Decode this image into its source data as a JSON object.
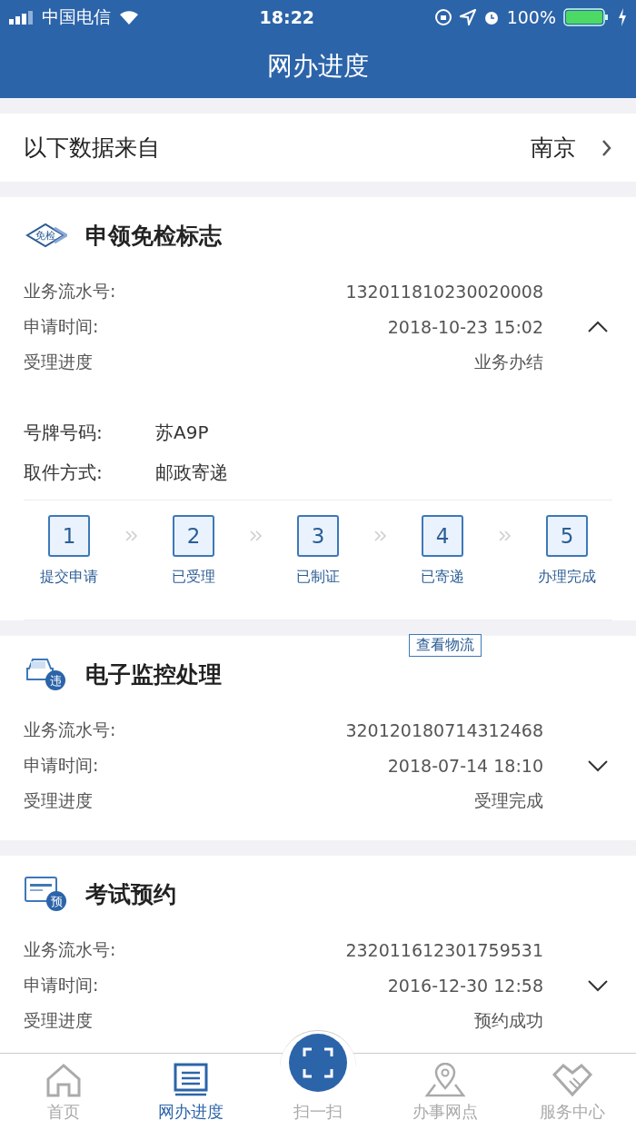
{
  "status_bar": {
    "carrier": "中国电信",
    "time": "18:22",
    "battery": "100%"
  },
  "title": "网办进度",
  "source": {
    "label": "以下数据来自",
    "value": "南京"
  },
  "cards": [
    {
      "kind": "badge",
      "icon_label": "免检",
      "title": "申领免检标志",
      "expanded": true,
      "fields": [
        {
          "label": "业务流水号:",
          "value": "132011810230020008"
        },
        {
          "label": "申请时间:",
          "value": "2018-10-23 15:02"
        },
        {
          "label": "受理进度",
          "value": "业务办结"
        }
      ],
      "details": [
        {
          "label": "号牌号码:",
          "value": "苏A9P"
        },
        {
          "label": "取件方式:",
          "value": "邮政寄递"
        }
      ],
      "steps": [
        {
          "number": "1",
          "label": "提交申请"
        },
        {
          "number": "2",
          "label": "已受理"
        },
        {
          "number": "3",
          "label": "已制证"
        },
        {
          "number": "4",
          "label": "已寄递"
        },
        {
          "number": "5",
          "label": "办理完成"
        }
      ],
      "action": "查看物流"
    },
    {
      "kind": "car",
      "icon_label": "违",
      "title": "电子监控处理",
      "expanded": false,
      "fields": [
        {
          "label": "业务流水号:",
          "value": "320120180714312468"
        },
        {
          "label": "申请时间:",
          "value": "2018-07-14 18:10"
        },
        {
          "label": "受理进度",
          "value": "受理完成"
        }
      ]
    },
    {
      "kind": "form",
      "icon_label": "预",
      "title": "考试预约",
      "expanded": false,
      "fields": [
        {
          "label": "业务流水号:",
          "value": "232011612301759531"
        },
        {
          "label": "申请时间:",
          "value": "2016-12-30 12:58"
        },
        {
          "label": "受理进度",
          "value": "预约成功"
        }
      ]
    }
  ],
  "tabs": [
    {
      "kind": "home",
      "label": "首页",
      "selected": false
    },
    {
      "kind": "progress",
      "label": "网办进度",
      "selected": true
    },
    {
      "kind": "scan",
      "label": "扫一扫",
      "selected": false
    },
    {
      "kind": "map",
      "label": "办事网点",
      "selected": false
    },
    {
      "kind": "service",
      "label": "服务中心",
      "selected": false
    }
  ]
}
